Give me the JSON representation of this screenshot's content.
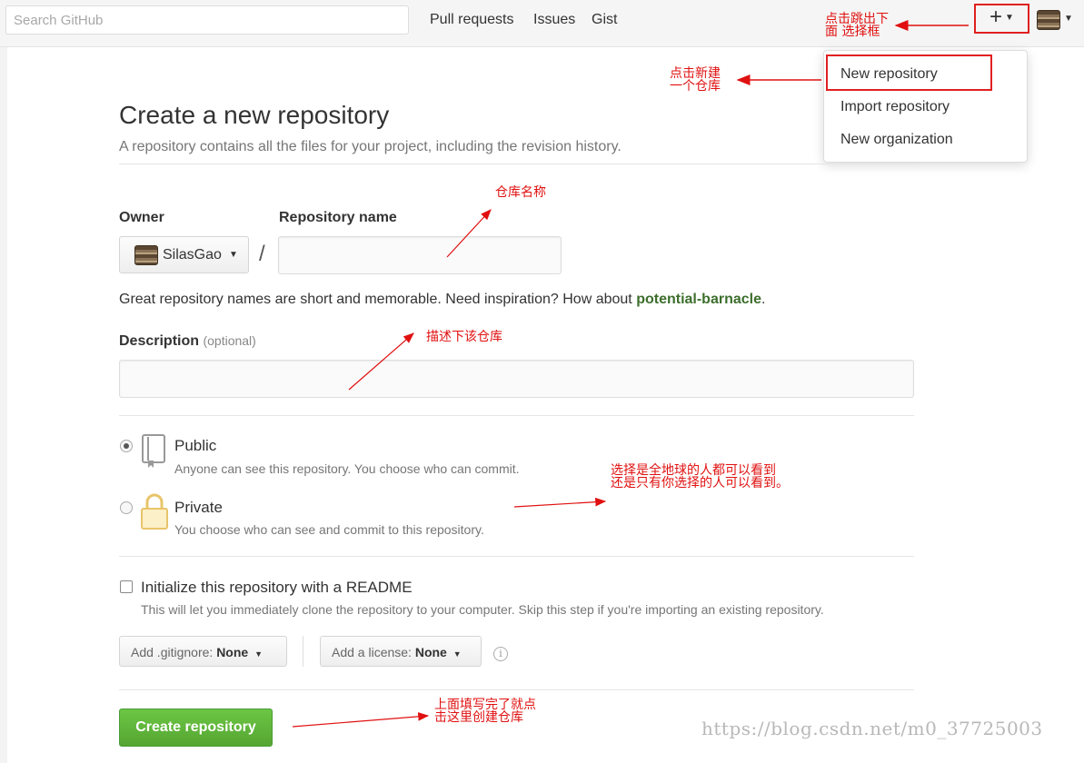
{
  "header": {
    "search_placeholder": "Search GitHub",
    "nav": [
      "Pull requests",
      "Issues",
      "Gist"
    ],
    "plus_label": "+"
  },
  "dropdown": {
    "items": [
      "New repository",
      "Import repository",
      "New organization"
    ]
  },
  "page": {
    "title": "Create a new repository",
    "subtitle": "A repository contains all the files for your project, including the revision history.",
    "owner_label": "Owner",
    "owner_value": "SilasGao",
    "repo_name_label": "Repository name",
    "repo_name_value": "",
    "slash": "/",
    "hint_prefix": "Great repository names are short and memorable. Need inspiration? How about ",
    "hint_suggestion": "potential-barnacle",
    "hint_suffix": ".",
    "description_label": "Description",
    "description_optional": "(optional)",
    "description_value": "",
    "visibility": {
      "selected": "Public",
      "public_title": "Public",
      "public_desc": "Anyone can see this repository. You choose who can commit.",
      "private_title": "Private",
      "private_desc": "You choose who can see and commit to this repository."
    },
    "readme_title": "Initialize this repository with a README",
    "readme_desc": "This will let you immediately clone the repository to your computer. Skip this step if you're importing an existing repository.",
    "readme_checked": false,
    "gitignore_label": "Add .gitignore:",
    "gitignore_value": "None",
    "license_label": "Add a license:",
    "license_value": "None",
    "create_button": "Create repository"
  },
  "annotations": {
    "plus_note_line1": "点击跳出下",
    "plus_note_line2": "面 选择框",
    "new_repo_note_line1": "点击新建",
    "new_repo_note_line2": "一个仓库",
    "repo_name_note": "仓库名称",
    "description_note": "描述下该仓库",
    "visibility_note_line1": "选择是全地球的人都可以看到",
    "visibility_note_line2": "还是只有你选择的人可以看到。",
    "create_note_line1": "上面填写完了就点",
    "create_note_line2": "击这里创建仓库",
    "annotation_color": "#e01010"
  },
  "watermark": "https://blog.csdn.net/m0_37725003",
  "colors": {
    "create_button": "#6cc644",
    "suggestion_link": "#3c6e2c",
    "highlight_box": "#e02020"
  }
}
